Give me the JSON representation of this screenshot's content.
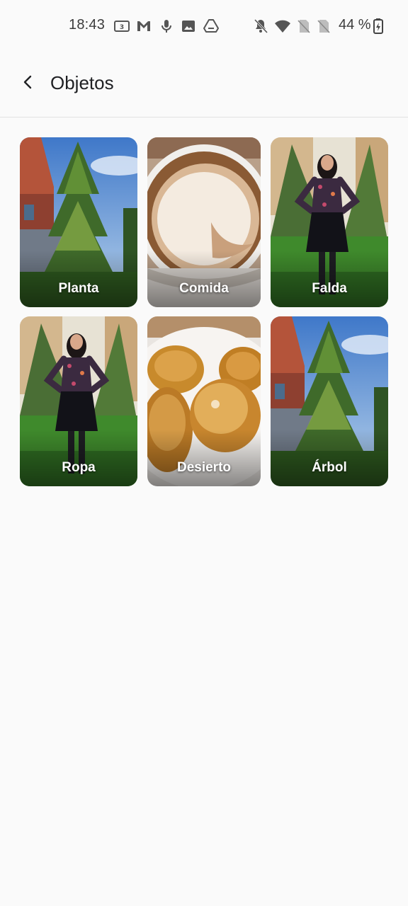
{
  "status_bar": {
    "time": "18:43",
    "battery": "44 %",
    "left_icons": [
      "signal-3g-icon",
      "gmail-icon",
      "microphone-icon",
      "gallery-icon",
      "drive-icon"
    ],
    "right_icons": [
      "notifications-off-icon",
      "wifi-icon",
      "no-sim-icon",
      "no-sim-icon",
      "battery-charging-icon"
    ]
  },
  "header": {
    "back_icon": "arrow-back-icon",
    "title": "Objetos"
  },
  "categories": [
    {
      "label": "Planta",
      "image": "tree"
    },
    {
      "label": "Comida",
      "image": "coffee"
    },
    {
      "label": "Falda",
      "image": "woman"
    },
    {
      "label": "Ropa",
      "image": "woman"
    },
    {
      "label": "Desierto",
      "image": "donuts"
    },
    {
      "label": "Árbol",
      "image": "tree"
    }
  ]
}
